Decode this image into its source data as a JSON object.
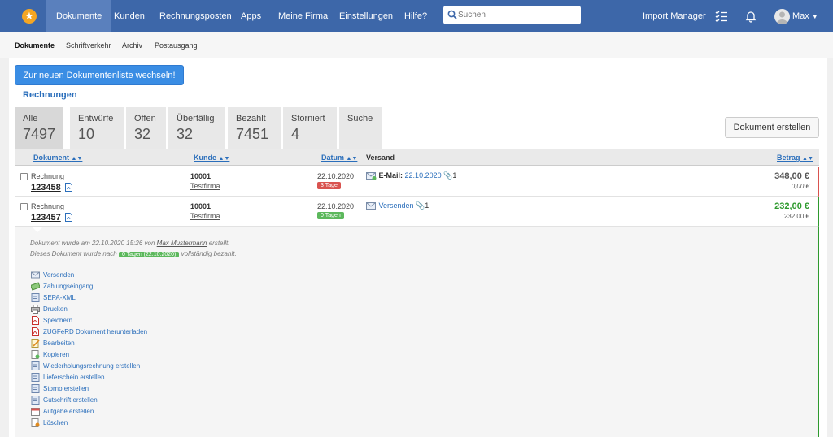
{
  "nav": {
    "items": [
      {
        "label": "Dokumente",
        "active": true
      },
      {
        "label": "Kunden"
      },
      {
        "label": "Rechnungsposten"
      },
      {
        "label": "Apps"
      },
      {
        "label": "Meine Firma"
      },
      {
        "label": "Einstellungen"
      },
      {
        "label": "Hilfe?"
      }
    ],
    "search_placeholder": "Suchen",
    "import_manager": "Import Manager",
    "user": "Max"
  },
  "subnav": [
    "Dokumente",
    "Schriftverkehr",
    "Archiv",
    "Postausgang"
  ],
  "switch_button": "Zur neuen Dokumentenliste wechseln!",
  "section_title": "Rechnungen",
  "tabs": [
    {
      "label": "Alle",
      "count": "7497"
    },
    {
      "label": "Entwürfe",
      "count": "10"
    },
    {
      "label": "Offen",
      "count": "32"
    },
    {
      "label": "Überfällig",
      "count": "32"
    },
    {
      "label": "Bezahlt",
      "count": "7451"
    },
    {
      "label": "Storniert",
      "count": "4"
    },
    {
      "label": "Suche",
      "count": ""
    }
  ],
  "create_button": "Dokument erstellen",
  "table": {
    "headers": {
      "dokument": "Dokument",
      "kunde": "Kunde",
      "datum": "Datum",
      "versand": "Versand",
      "betrag": "Betrag"
    },
    "rows": [
      {
        "type": "Rechnung",
        "number": "123458",
        "customer_number": "10001",
        "customer_name": "Testfirma",
        "date": "22.10.2020",
        "badge": "3 Tage",
        "badge_color": "#d9534f",
        "versand_label": "E-Mail:",
        "versand_link": "22.10.2020",
        "attachments": "1",
        "amount": "348,00 €",
        "open": "0,00 €"
      },
      {
        "type": "Rechnung",
        "number": "123457",
        "customer_number": "10001",
        "customer_name": "Testfirma",
        "date": "22.10.2020",
        "badge": "0 Tagen",
        "badge_color": "#5cb85c",
        "versand_label": "",
        "versand_link": "Versenden",
        "attachments": "1",
        "amount": "232,00 €",
        "open": "232,00 €"
      }
    ]
  },
  "detail": {
    "created_prefix": "Dokument wurde am 22.10.2020 15:26 von",
    "created_by": "Max Mustermann",
    "created_suffix": "erstellt.",
    "paid_prefix": "Dieses Dokument wurde nach",
    "paid_pill": "0 Tagen (22.10.2020)",
    "paid_suffix": "vollständig bezahlt.",
    "actions": [
      {
        "label": "Versenden",
        "icon": "envelope-icon"
      },
      {
        "label": "Zahlungseingang",
        "icon": "money-icon"
      },
      {
        "label": "SEPA-XML",
        "icon": "sepa-icon"
      },
      {
        "label": "Drucken",
        "icon": "printer-icon"
      },
      {
        "label": "Speichern",
        "icon": "pdf-icon"
      },
      {
        "label": "ZUGFeRD Dokument herunterladen",
        "icon": "pdf-icon"
      },
      {
        "label": "Bearbeiten",
        "icon": "edit-icon"
      },
      {
        "label": "Kopieren",
        "icon": "copy-icon"
      },
      {
        "label": "Wiederholungsrechnung erstellen",
        "icon": "document-icon"
      },
      {
        "label": "Lieferschein erstellen",
        "icon": "document-icon"
      },
      {
        "label": "Storno erstellen",
        "icon": "document-icon"
      },
      {
        "label": "Gutschrift erstellen",
        "icon": "document-icon"
      },
      {
        "label": "Aufgabe erstellen",
        "icon": "calendar-icon"
      },
      {
        "label": "Löschen",
        "icon": "delete-icon"
      }
    ]
  }
}
